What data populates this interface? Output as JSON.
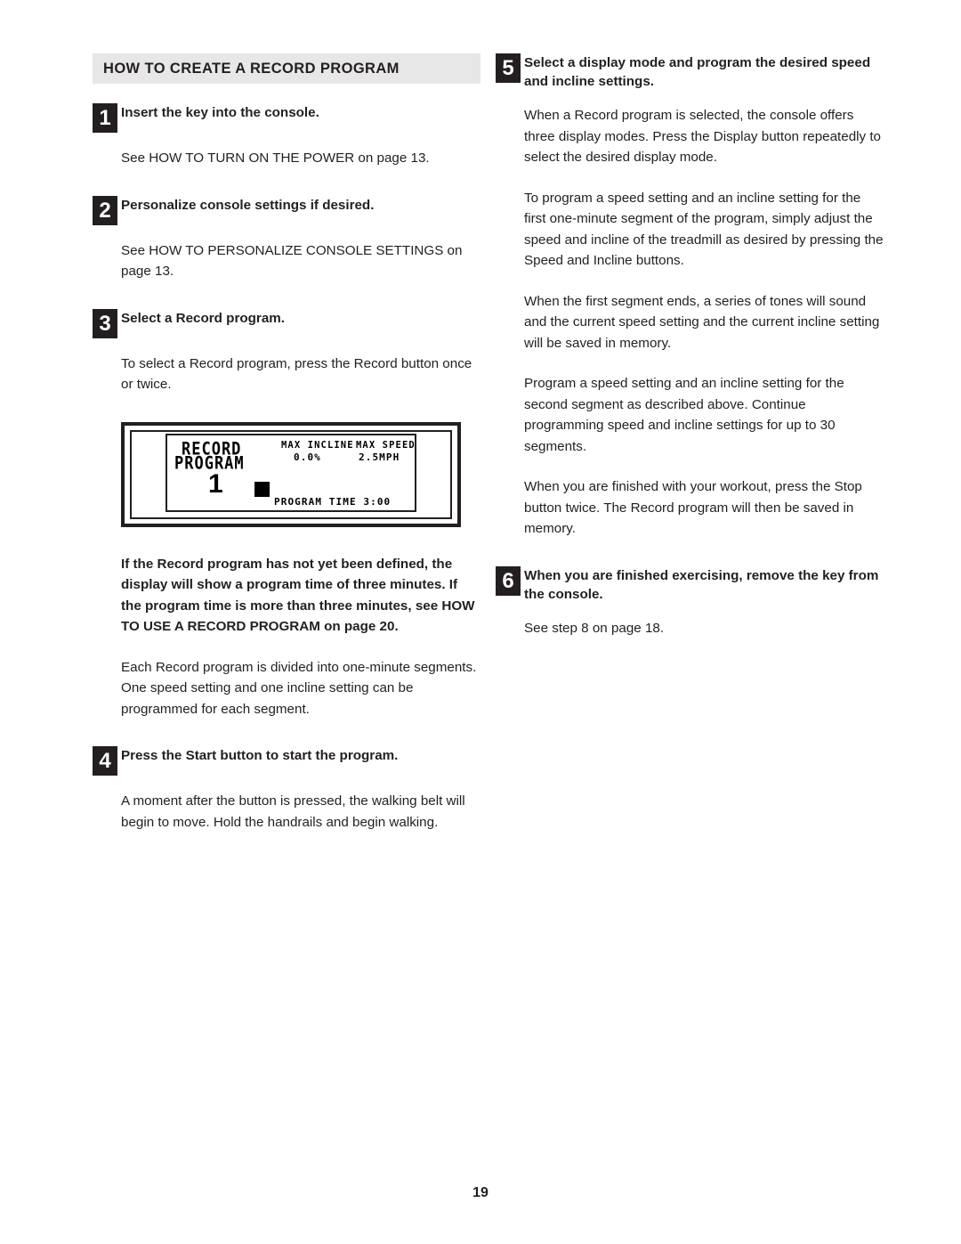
{
  "document": {
    "page_number": "19",
    "section_title": "HOW TO CREATE A RECORD PROGRAM"
  },
  "left_column": {
    "steps": [
      {
        "number": "1",
        "title": "Insert the key into the console.",
        "body": "See HOW TO TURN ON THE POWER on page 13."
      },
      {
        "number": "2",
        "title": "Personalize console settings if desired.",
        "body": "See HOW TO PERSONALIZE CONSOLE SETTINGS on page 13."
      },
      {
        "number": "3",
        "title": "Select a Record program.",
        "body": "To select a Record program, press the Record button once or twice."
      },
      {
        "number": "4",
        "title": "Press the Start button to start the program.",
        "body": "A moment after the button is pressed, the walking belt will begin to move. Hold the handrails and begin walking."
      }
    ],
    "note_bold": "If the Record program has not yet been defined, the display will show a program time of three minutes. If the program time is more than three minutes, see HOW TO USE A RECORD PROGRAM on page 20.",
    "note_body": "Each Record program is divided into one-minute segments. One speed setting and one incline setting can be programmed for each segment."
  },
  "console_display": {
    "title_line1": "RECORD",
    "title_line2": "PROGRAM",
    "program_number": "1",
    "max_incline_label": "MAX INCLINE",
    "max_incline_value": "0.0%",
    "max_speed_label": "MAX SPEED",
    "max_speed_value": "2.5MPH",
    "program_time": "PROGRAM TIME  3:00"
  },
  "right_column": {
    "steps": [
      {
        "number": "5",
        "title": "Select a display mode and program the desired speed and incline settings.",
        "paragraphs": [
          "When a Record program is selected, the console offers three display modes. Press the Display button repeatedly to select the desired display mode.",
          "To program a speed setting and an incline setting for the first one-minute segment of the program, simply adjust the speed and incline of the treadmill as desired by pressing the Speed and Incline buttons.",
          "When the first segment ends, a series of tones will sound and the current speed setting and the current incline setting will be saved in memory.",
          "Program a speed setting and an incline setting for the second segment as described above. Continue programming speed and incline settings for up to 30 segments.",
          "When you are finished with your workout, press the Stop button twice. The Record program will then be saved in memory."
        ]
      },
      {
        "number": "6",
        "title": "When you are finished exercising, remove the key from the console.",
        "paragraphs": [
          "See step 8 on page 18."
        ]
      }
    ]
  }
}
